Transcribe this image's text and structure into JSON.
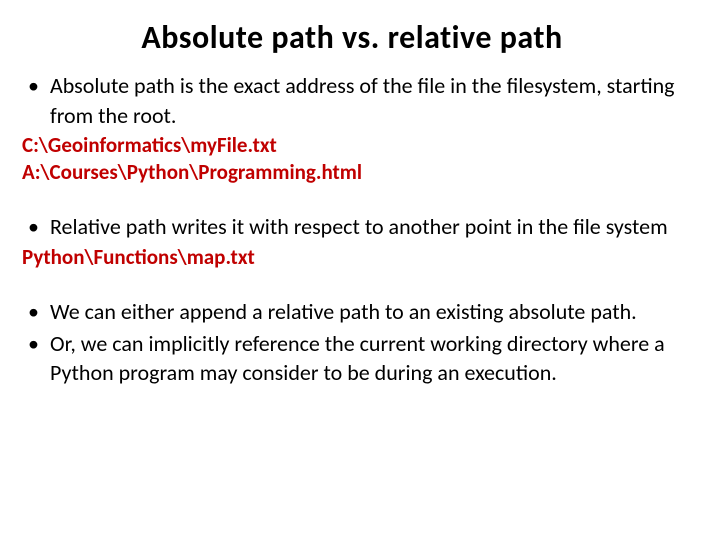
{
  "title": "Absolute path vs. relative path",
  "bullets": {
    "b1": "Absolute path is the exact address of the file in the filesystem, starting from the root.",
    "b2": "Relative path writes it with respect to another point in the file system",
    "b3": "We can either append a relative path to an existing absolute path.",
    "b4": "Or, we can implicitly reference the current working directory where a Python program may consider to be during an execution."
  },
  "paths": {
    "p1": "C:\\Geoinformatics\\myFile.txt",
    "p2": "A:\\Courses\\Python\\Programming.html",
    "p3": "Python\\Functions\\map.txt"
  }
}
